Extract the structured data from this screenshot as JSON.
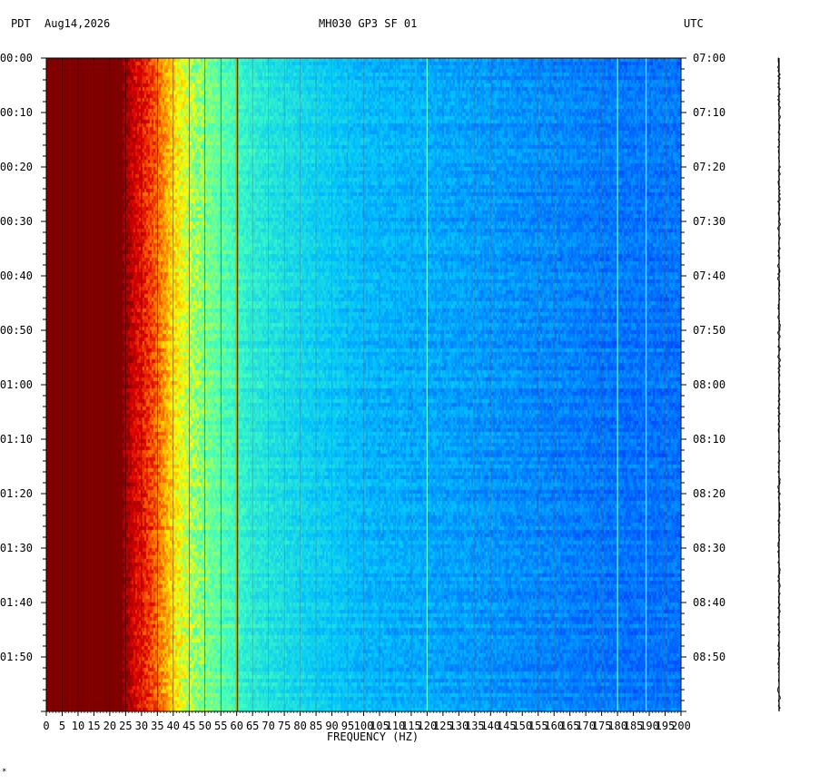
{
  "header": {
    "left_tz": "PDT",
    "date": "Aug14,2026",
    "station": "MH030 GP3 SF 01",
    "right_tz": "UTC"
  },
  "chart_data": {
    "type": "heatmap",
    "title": "MH030 GP3 SF 01",
    "xlabel": "FREQUENCY (HZ)",
    "xlim": [
      0,
      200
    ],
    "x_ticks": [
      0,
      5,
      10,
      15,
      20,
      25,
      30,
      35,
      40,
      45,
      50,
      55,
      60,
      65,
      70,
      75,
      80,
      85,
      90,
      95,
      100,
      105,
      110,
      115,
      120,
      125,
      130,
      135,
      140,
      145,
      150,
      155,
      160,
      165,
      170,
      175,
      180,
      185,
      190,
      195,
      200
    ],
    "left_time_labels": [
      "00:00",
      "00:10",
      "00:20",
      "00:30",
      "00:40",
      "00:50",
      "01:00",
      "01:10",
      "01:20",
      "01:30",
      "01:40",
      "01:50"
    ],
    "right_time_labels": [
      "07:00",
      "07:10",
      "07:20",
      "07:30",
      "07:40",
      "07:50",
      "08:00",
      "08:10",
      "08:20",
      "08:30",
      "08:40",
      "08:50"
    ],
    "time_range_minutes": 120,
    "vertical_gridlines_hz": [
      5,
      10,
      15,
      20,
      25,
      30,
      35,
      40,
      45,
      50,
      55,
      60,
      65,
      70,
      75,
      80,
      85,
      90,
      95,
      100,
      105,
      110,
      115,
      120,
      125,
      130,
      135,
      140,
      145,
      150,
      155,
      160,
      165,
      170,
      175,
      180,
      185,
      190,
      195
    ],
    "spectral_lines_hz": [
      60,
      120,
      180,
      189
    ],
    "colormap": [
      "#00008f",
      "#0040ff",
      "#00c0ff",
      "#40ffbf",
      "#ffff00",
      "#ff8000",
      "#e00000",
      "#800000"
    ],
    "intensity_profile": {
      "freq_hz": [
        0,
        24,
        28,
        34,
        40,
        46,
        55,
        65,
        80,
        100,
        130,
        160,
        180,
        200
      ],
      "level": [
        1.0,
        0.97,
        0.87,
        0.76,
        0.6,
        0.5,
        0.44,
        0.38,
        0.33,
        0.28,
        0.25,
        0.22,
        0.2,
        0.2
      ]
    }
  },
  "footer": {
    "mark": "*"
  }
}
